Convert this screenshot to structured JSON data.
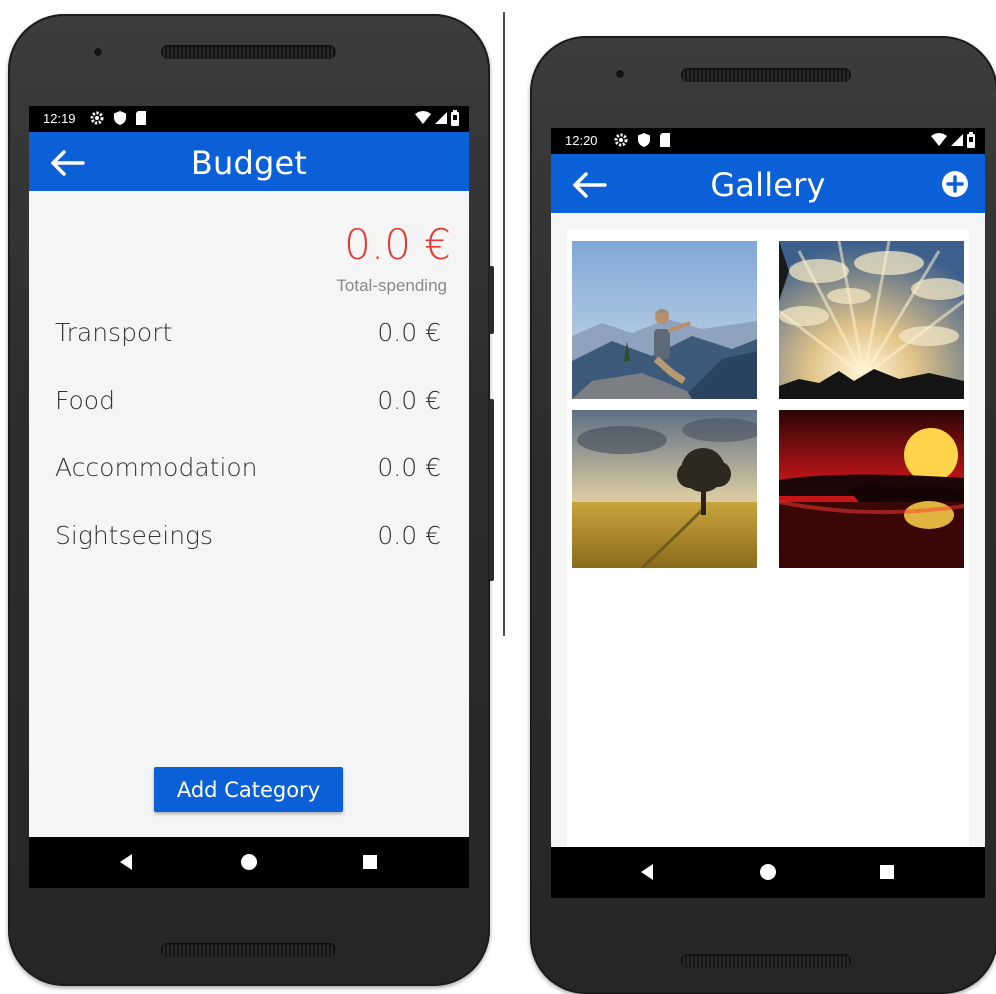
{
  "budget_screen": {
    "status_time": "12:19",
    "title": "Budget",
    "total_amount": "0.0 €",
    "total_label": "Total-spending",
    "categories": [
      {
        "name": "Transport",
        "value": "0.0 €"
      },
      {
        "name": "Food",
        "value": "0.0 €"
      },
      {
        "name": "Accommodation",
        "value": "0.0 €"
      },
      {
        "name": "Sightseeings",
        "value": "0.0 €"
      }
    ],
    "add_button_label": "Add Category"
  },
  "gallery_screen": {
    "status_time": "12:20",
    "title": "Gallery",
    "photos": [
      {
        "subject": "hiker on mountain summit"
      },
      {
        "subject": "sunrays through clouds"
      },
      {
        "subject": "lone tree in wheat field"
      },
      {
        "subject": "red sunset over lake"
      }
    ]
  },
  "icons": {
    "back": "arrow-left-icon",
    "add": "plus-circle-icon",
    "nav_back": "triangle-back-icon",
    "nav_home": "circle-home-icon",
    "nav_recents": "square-recents-icon"
  },
  "colors": {
    "appbar": "#0b60d8",
    "total_amount": "#e53935",
    "button": "#0b60d8"
  }
}
